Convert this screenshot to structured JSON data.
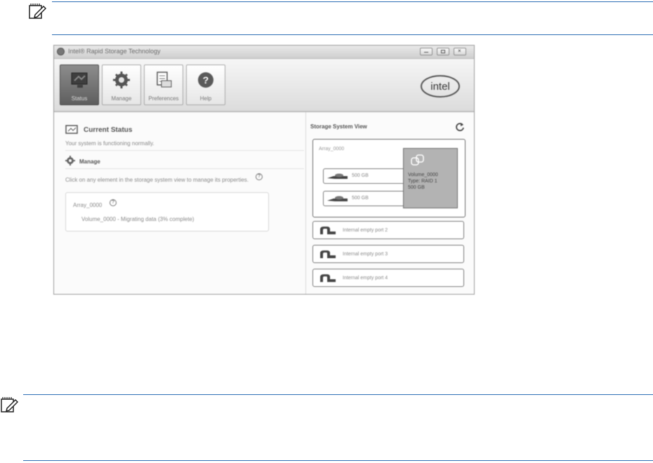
{
  "window": {
    "title": "Intel® Rapid Storage Technology",
    "controls": [
      "minimize",
      "maximize",
      "close"
    ]
  },
  "toolbar": {
    "buttons": [
      {
        "label": "Status",
        "icon": "monitor-icon",
        "active": true
      },
      {
        "label": "Manage",
        "icon": "gear-icon",
        "active": false
      },
      {
        "label": "Preferences",
        "icon": "preferences-icon",
        "active": false
      },
      {
        "label": "Help",
        "icon": "help-icon",
        "active": false
      }
    ],
    "logo": "intel"
  },
  "left": {
    "status_title": "Current Status",
    "status_text": "Your system is functioning normally.",
    "manage_title": "Manage",
    "manage_text": "Click on any element in the storage system view to manage its properties.",
    "array_name": "Array_0000",
    "volume_status": "Volume_0000 - Migrating data (3% complete)"
  },
  "right": {
    "title": "Storage System View",
    "volume_label": "Array_0000",
    "disks": [
      "500 GB",
      "500 GB"
    ],
    "raid_info": [
      "Volume_0000",
      "Type: RAID 1",
      "500 GB"
    ],
    "ports": [
      "Internal empty port 2",
      "Internal empty port 3",
      "Internal empty port 4"
    ]
  },
  "colors": {
    "rule": "#2f6fb5",
    "active_button": "#6e6e6e",
    "raid_panel": "#b3b3b3"
  }
}
